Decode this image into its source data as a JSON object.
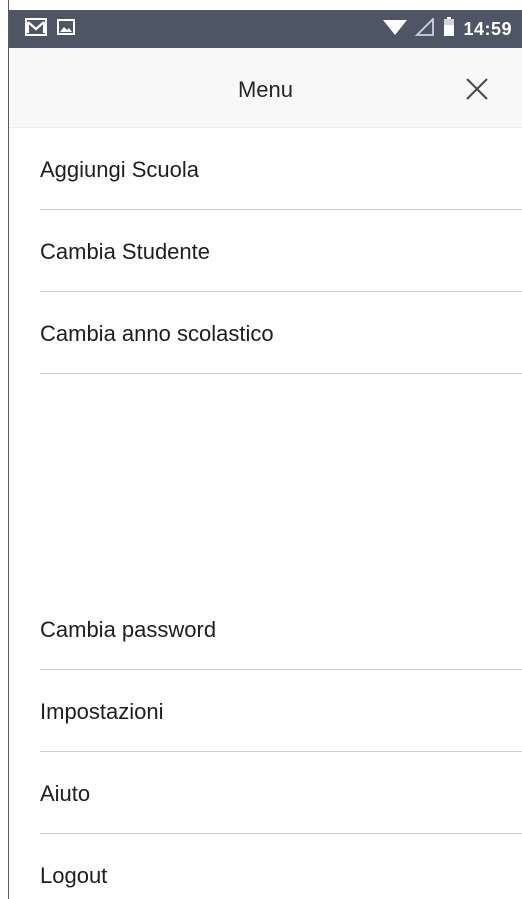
{
  "status_bar": {
    "time": "14:59",
    "icons": [
      "gmail-icon",
      "image-icon",
      "wifi-icon",
      "signal-icon",
      "battery-icon"
    ],
    "background": "#4e5564"
  },
  "header": {
    "title": "Menu",
    "close_icon": "close-icon"
  },
  "menu": {
    "top_items": [
      {
        "label": "Aggiungi Scuola"
      },
      {
        "label": "Cambia Studente"
      },
      {
        "label": "Cambia anno scolastico"
      }
    ],
    "bottom_items": [
      {
        "label": "Cambia password"
      },
      {
        "label": "Impostazioni"
      },
      {
        "label": "Aiuto"
      },
      {
        "label": "Logout"
      }
    ]
  }
}
